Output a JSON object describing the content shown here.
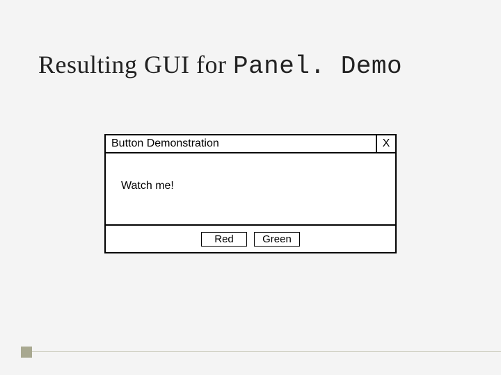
{
  "slide": {
    "title_prefix": "Resulting GUI for ",
    "title_code": "Panel. Demo"
  },
  "window": {
    "title": "Button Demonstration",
    "close_label": "X",
    "message": "Watch me!",
    "buttons": {
      "red": "Red",
      "green": "Green"
    }
  }
}
